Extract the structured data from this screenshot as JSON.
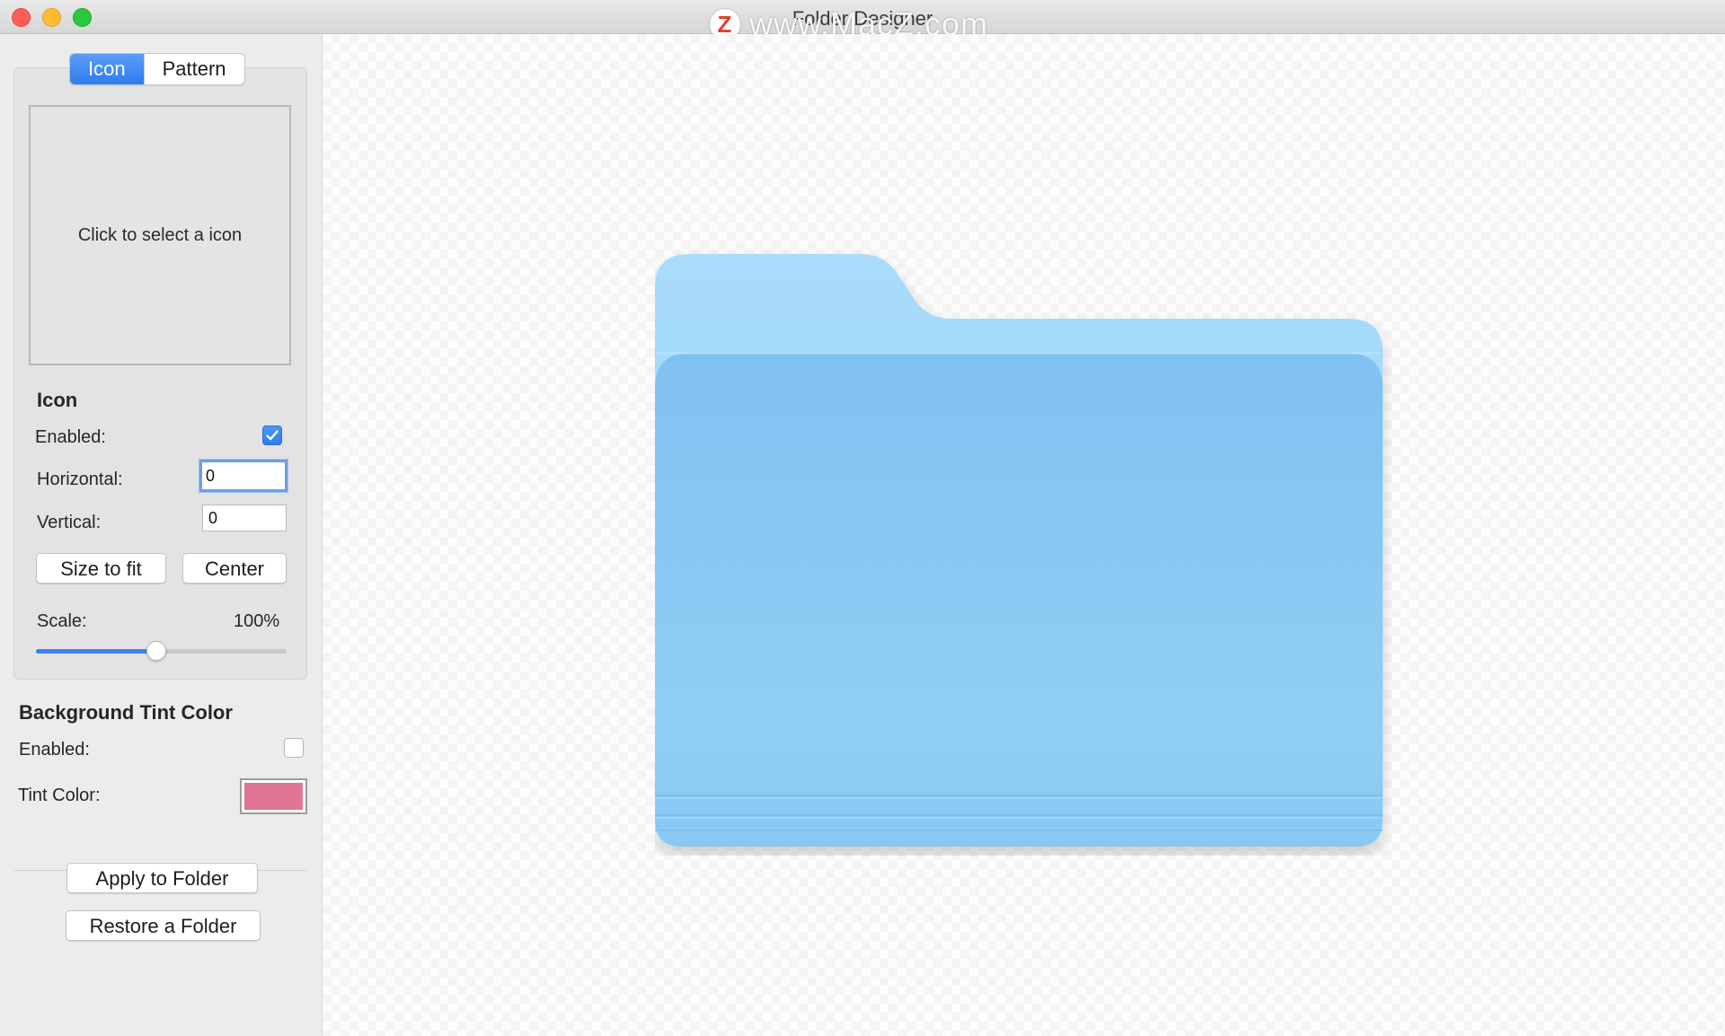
{
  "window": {
    "title": "Folder Designer",
    "watermark_text": "www.MacZ.com",
    "watermark_logo": "Z"
  },
  "tabs": [
    {
      "label": "Icon",
      "active": true
    },
    {
      "label": "Pattern",
      "active": false
    }
  ],
  "icon_well": {
    "placeholder": "Click to select a icon"
  },
  "icon_section": {
    "title": "Icon",
    "enabled_label": "Enabled:",
    "enabled": true,
    "horizontal_label": "Horizontal:",
    "horizontal_value": "0",
    "vertical_label": "Vertical:",
    "vertical_value": "0",
    "size_to_fit_label": "Size to fit",
    "center_label": "Center",
    "scale_label": "Scale:",
    "scale_value": "100%",
    "scale_slider_fraction": 0.48
  },
  "background_tint": {
    "title": "Background Tint Color",
    "enabled_label": "Enabled:",
    "enabled": false,
    "tint_label": "Tint Color:",
    "tint_color": "#e07593"
  },
  "actions": {
    "apply_label": "Apply to Folder",
    "restore_label": "Restore a Folder"
  },
  "preview": {
    "folder_icon": "folder-icon",
    "folder_color": "#8ccbf3"
  }
}
